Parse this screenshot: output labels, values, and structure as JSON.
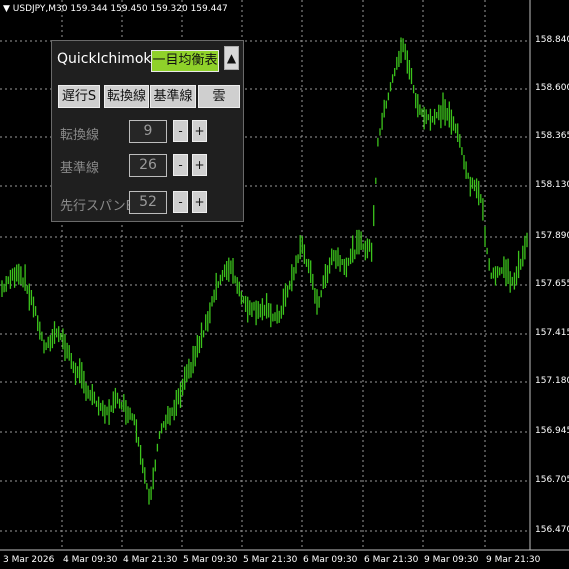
{
  "symbol_header": "▼ USDJPY,M30  159.344 159.450 159.320 159.447",
  "price_axis": [
    "158.840",
    "158.600",
    "158.365",
    "158.130",
    "157.890",
    "157.655",
    "157.415",
    "157.180",
    "156.945",
    "156.705",
    "156.470"
  ],
  "time_axis": [
    "3 Mar 2026",
    "4 Mar 09:30",
    "4 Mar 21:30",
    "5 Mar 09:30",
    "5 Mar 21:30",
    "6 Mar 09:30",
    "6 Mar 21:30",
    "9 Mar 09:30",
    "9 Mar 21:30"
  ],
  "colors": {
    "background": "#000000",
    "grid": "#9a9a9a",
    "candle": "#3cc41c",
    "panel_bg": "#1f1f1f",
    "accent": "#8fd12a"
  },
  "panel": {
    "title": "QuickIchimoku",
    "mode_button": "一目均衡表",
    "collapse_icon": "▲",
    "line_buttons": [
      "遅行S",
      "転換線",
      "基準線",
      "雲"
    ],
    "params": [
      {
        "label": "転換線",
        "value": "9",
        "minus": "-",
        "plus": "+"
      },
      {
        "label": "基準線",
        "value": "26",
        "minus": "-",
        "plus": "+"
      },
      {
        "label": "先行スパンB",
        "value": "52",
        "minus": "-",
        "plus": "+"
      }
    ]
  }
}
